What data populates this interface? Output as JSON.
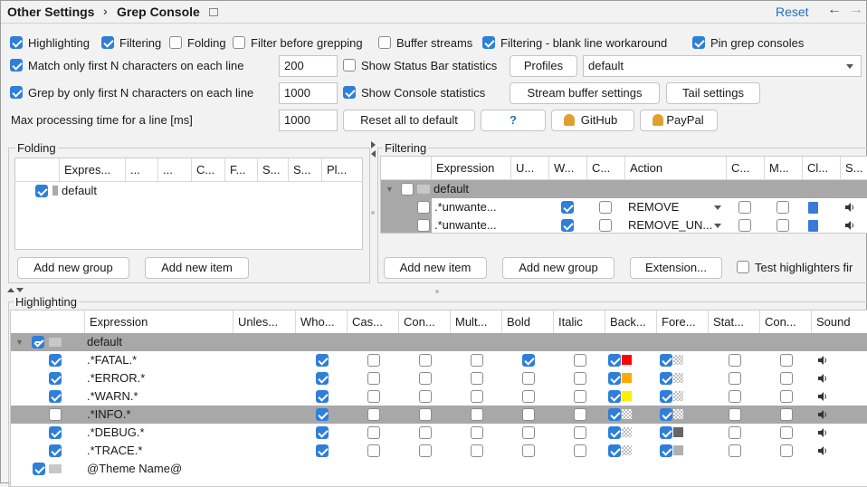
{
  "header": {
    "breadcrumb_parent": "Other Settings",
    "breadcrumb_sep": "›",
    "breadcrumb_current": "Grep Console",
    "reset_label": "Reset",
    "back_icon": "←",
    "forward_icon": "→"
  },
  "options": {
    "highlighting": "Highlighting",
    "filtering": "Filtering",
    "folding": "Folding",
    "filter_before": "Filter before grepping",
    "buffer_streams": "Buffer streams",
    "blank_line": "Filtering - blank line workaround",
    "pin": "Pin grep consoles",
    "match_first": "Match only first N characters on each line",
    "match_value": "200",
    "status_bar": "Show Status Bar statistics",
    "profiles": "Profiles",
    "profile_value": "default",
    "grep_first": "Grep by only first N characters on each line",
    "grep_value": "1000",
    "console_stats": "Show Console statistics",
    "stream_buffer": "Stream buffer settings",
    "tail": "Tail settings",
    "max_time": "Max processing time for a line [ms]",
    "max_value": "1000",
    "reset_all": "Reset all to default",
    "help": "?",
    "github": "GitHub",
    "paypal": "PayPal"
  },
  "folding": {
    "title": "Folding",
    "headers": [
      "Expres...",
      "...",
      "...",
      "C...",
      "F...",
      "S...",
      "S...",
      "Pl..."
    ],
    "row_label": "default",
    "add_group": "Add new group",
    "add_item": "Add new item"
  },
  "filtering": {
    "title": "Filtering",
    "headers": [
      "Expression",
      "U...",
      "W...",
      "C...",
      "Action",
      "C...",
      "M...",
      "Cl...",
      "S..."
    ],
    "group": "default",
    "rows": [
      {
        "expr": ".*unwante...",
        "action": "REMOVE"
      },
      {
        "expr": ".*unwante...",
        "action": "REMOVE_UN..."
      }
    ],
    "add_item": "Add new item",
    "add_group": "Add new group",
    "extension": "Extension...",
    "test": "Test highlighters fir"
  },
  "highlighting": {
    "title": "Highlighting",
    "headers": [
      "Expression",
      "Unles...",
      "Who...",
      "Cas...",
      "Con...",
      "Mult...",
      "Bold",
      "Italic",
      "Back...",
      "Fore...",
      "Stat...",
      "Con...",
      "Sound"
    ],
    "group": "default",
    "rows": [
      {
        "expr": ".*FATAL.*",
        "on": true,
        "bold": true,
        "bg": "#ff0000",
        "fg": "chk"
      },
      {
        "expr": ".*ERROR.*",
        "on": true,
        "bold": false,
        "bg": "#ffaa00",
        "fg": "chk"
      },
      {
        "expr": ".*WARN.*",
        "on": true,
        "bold": false,
        "bg": "#ffee00",
        "fg": "chk"
      },
      {
        "expr": ".*INFO.*",
        "on": false,
        "bold": false,
        "bg": "chk",
        "fg": "chk"
      },
      {
        "expr": ".*DEBUG.*",
        "on": true,
        "bold": false,
        "bg": "chk",
        "fg": "#666666"
      },
      {
        "expr": ".*TRACE.*",
        "on": true,
        "bold": false,
        "bg": "chk",
        "fg": "#b0b0b0"
      }
    ],
    "theme": "@Theme Name@"
  }
}
